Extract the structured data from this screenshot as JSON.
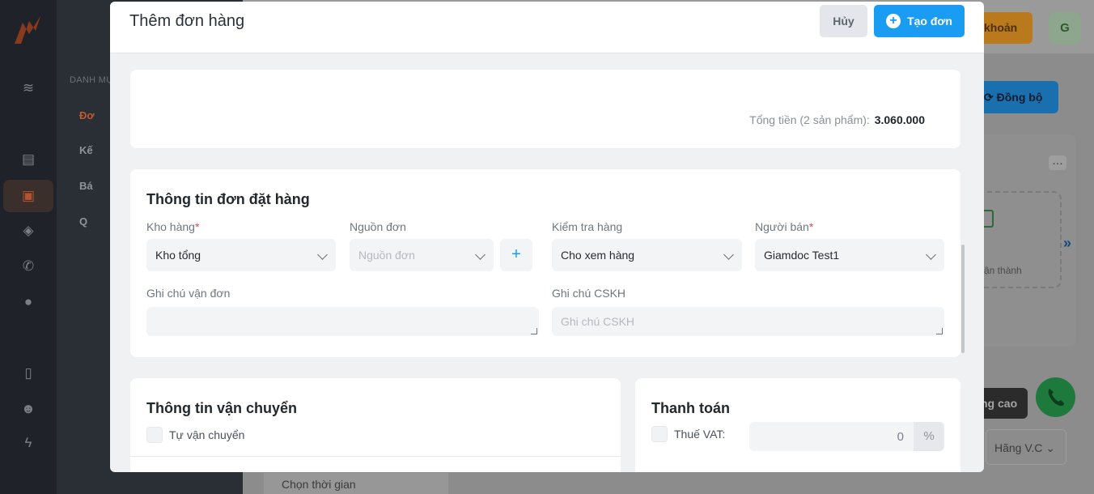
{
  "background": {
    "sidebar_label": "DANH MỤC",
    "sub_items": [
      "Đơ",
      "Kế",
      "Bá",
      "Q"
    ],
    "account_button": "khoản",
    "avatar_letter": "G",
    "sync_button": "Đồng bộ",
    "card_status": "ận thành",
    "advanced_button": "ng cao",
    "carrier_select": "Hãng V.C",
    "time_select": "Chọn thời gian"
  },
  "modal": {
    "title": "Thêm đơn hàng",
    "cancel_label": "Hủy",
    "create_label": "Tạo đơn"
  },
  "summary": {
    "total_label": "Tổng tiền (2 sản phẩm):",
    "total_value": "3.060.000"
  },
  "order_info": {
    "title": "Thông tin đơn đặt hàng",
    "warehouse": {
      "label": "Kho hàng",
      "required": "*",
      "value": "Kho tổng"
    },
    "source": {
      "label": "Nguồn đơn",
      "placeholder": "Nguồn đơn",
      "add_icon": "+"
    },
    "inspection": {
      "label": "Kiểm tra hàng",
      "value": "Cho xem hàng"
    },
    "seller": {
      "label": "Người bán",
      "required": "*",
      "value": "Giamdoc Test1"
    },
    "shipping_note": {
      "label": "Ghi chú vận đơn",
      "placeholder": ""
    },
    "cs_note": {
      "label": "Ghi chú CSKH",
      "placeholder": "Ghi chú CSKH"
    }
  },
  "shipping": {
    "title": "Thông tin vận chuyển",
    "self_ship_label": "Tự vận chuyển"
  },
  "payment": {
    "title": "Thanh toán",
    "vat_label": "Thuế VAT:",
    "vat_value": "0",
    "vat_unit": "%"
  },
  "colors": {
    "primary": "#1a9cf2",
    "required": "#e5484d",
    "accent_orange": "#c05a2f"
  }
}
